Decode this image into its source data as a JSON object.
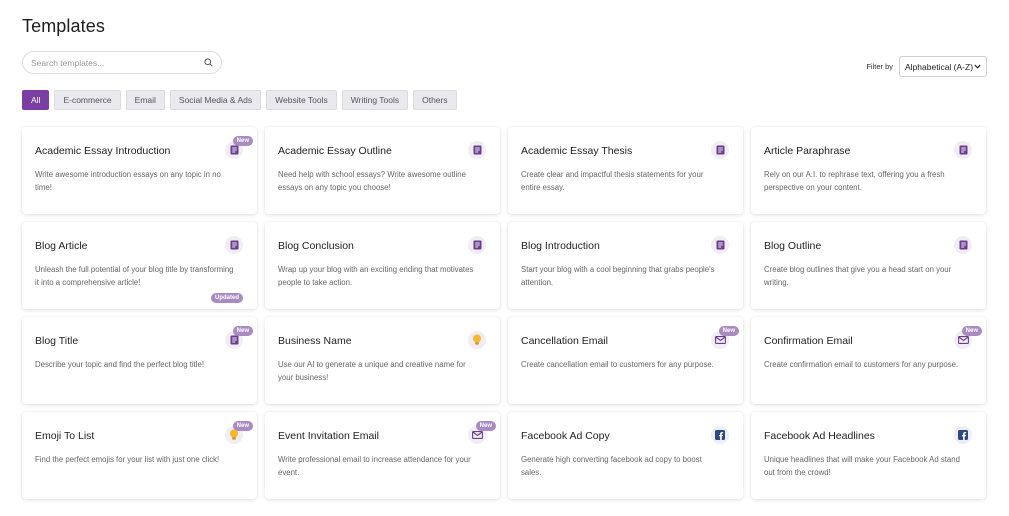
{
  "page": {
    "title": "Templates"
  },
  "search": {
    "placeholder": "Search templates..."
  },
  "filter": {
    "label": "Filter by",
    "selected": "Alphabetical (A-Z)"
  },
  "tabs": [
    {
      "label": "All",
      "active": true
    },
    {
      "label": "E-commerce",
      "active": false
    },
    {
      "label": "Email",
      "active": false
    },
    {
      "label": "Social Media & Ads",
      "active": false
    },
    {
      "label": "Website Tools",
      "active": false
    },
    {
      "label": "Writing Tools",
      "active": false
    },
    {
      "label": "Others",
      "active": false
    }
  ],
  "colors": {
    "accent": "#7b3fa3",
    "icon_purple": "#6a3d8f",
    "badge": "#a98ac2",
    "bulb": "#f5b72b",
    "facebook": "#2a4a86"
  },
  "cards": [
    {
      "title": "Academic Essay Introduction",
      "desc": "Write awesome introduction essays on any topic in no time!",
      "icon": "document-icon",
      "badge": "New"
    },
    {
      "title": "Academic Essay Outline",
      "desc": "Need help with school essays? Write awesome outline essays on any topic you choose!",
      "icon": "document-icon"
    },
    {
      "title": "Academic Essay Thesis",
      "desc": "Create clear and impactful thesis statements for your entire essay.",
      "icon": "document-icon"
    },
    {
      "title": "Article Paraphrase",
      "desc": "Rely on our A.I. to rephrase text, offering you a fresh perspective on your content.",
      "icon": "document-icon"
    },
    {
      "title": "Blog Article",
      "desc": "Unleash the full potential of your blog title by transforming it into a comprehensive article!",
      "icon": "document-icon",
      "badge_bottom": "Updated"
    },
    {
      "title": "Blog Conclusion",
      "desc": "Wrap up your blog with an exciting ending that motivates people to take action.",
      "icon": "document-icon"
    },
    {
      "title": "Blog Introduction",
      "desc": "Start your blog with a cool beginning that grabs people's attention.",
      "icon": "document-icon"
    },
    {
      "title": "Blog Outline",
      "desc": "Create blog outlines that give you a head start on your writing.",
      "icon": "document-icon"
    },
    {
      "title": "Blog Title",
      "desc": "Describe your topic and find the perfect blog title!",
      "icon": "document-icon",
      "badge": "New"
    },
    {
      "title": "Business Name",
      "desc": "Use our AI to generate a unique and creative name for your business!",
      "icon": "lightbulb-icon"
    },
    {
      "title": "Cancellation Email",
      "desc": "Create cancellation email to customers for any purpose.",
      "icon": "envelope-icon",
      "badge": "New"
    },
    {
      "title": "Confirmation Email",
      "desc": "Create confirmation email to customers for any purpose.",
      "icon": "envelope-icon",
      "badge": "New"
    },
    {
      "title": "Emoji To List",
      "desc": "Find the perfect emojis for your list with just one click!",
      "icon": "lightbulb-icon",
      "badge": "New"
    },
    {
      "title": "Event Invitation Email",
      "desc": "Write professional email to increase attendance for your event.",
      "icon": "envelope-icon",
      "badge": "New"
    },
    {
      "title": "Facebook Ad Copy",
      "desc": "Generate high converting facebook ad copy to boost sales.",
      "icon": "facebook-icon"
    },
    {
      "title": "Facebook Ad Headlines",
      "desc": "Unique headlines that will make your Facebook Ad stand out from the crowd!",
      "icon": "facebook-icon"
    }
  ]
}
